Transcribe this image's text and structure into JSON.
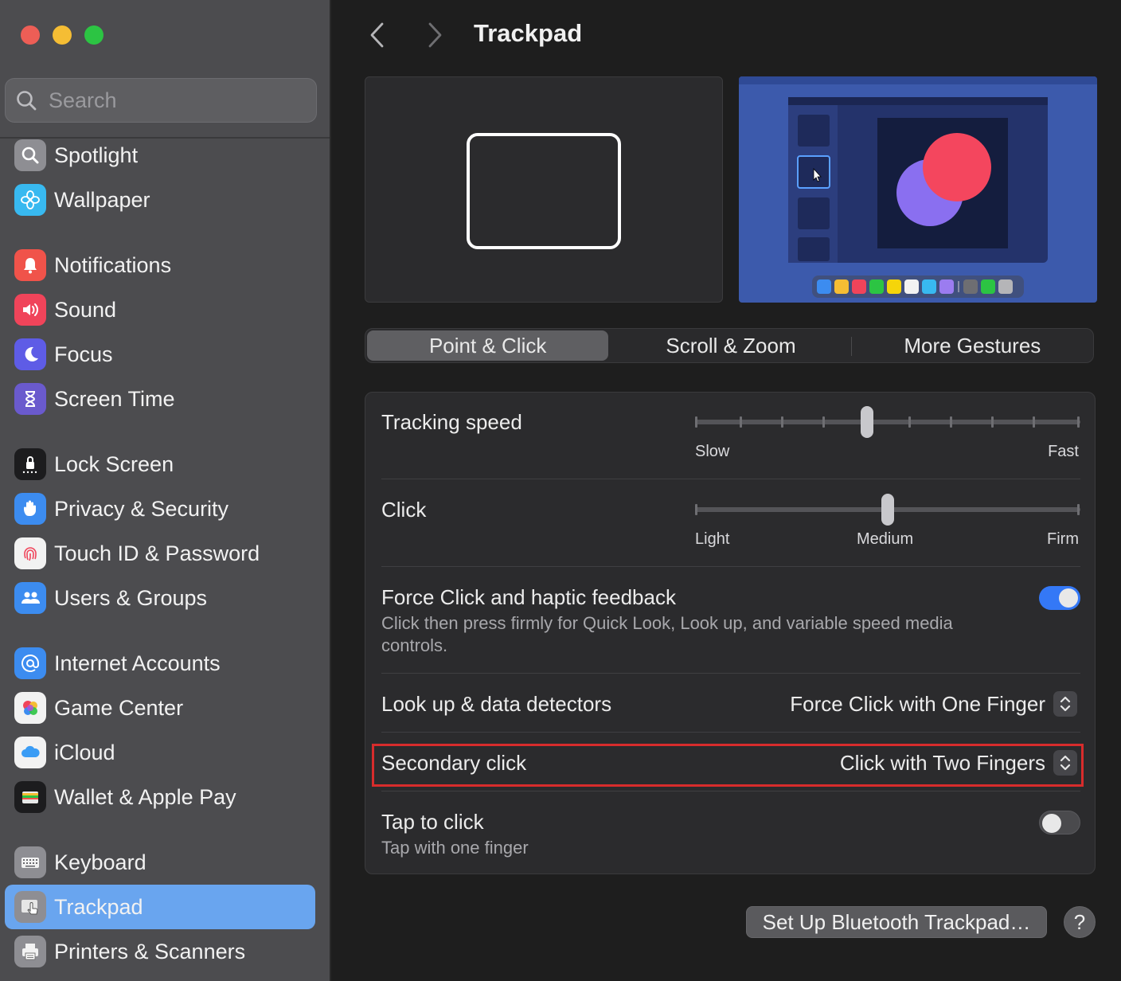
{
  "window": {
    "title": "Trackpad"
  },
  "search": {
    "placeholder": "Search"
  },
  "sidebar": {
    "items": [
      {
        "label": "Spotlight",
        "icon": "magnifier-icon",
        "color": "#8e8e93"
      },
      {
        "label": "Wallpaper",
        "icon": "flower-icon",
        "color": "#38b9f0"
      },
      {
        "label": "Notifications",
        "icon": "bell-icon",
        "color": "#f0534a"
      },
      {
        "label": "Sound",
        "icon": "speaker-icon",
        "color": "#f0445a"
      },
      {
        "label": "Focus",
        "icon": "moon-icon",
        "color": "#5e5ce6"
      },
      {
        "label": "Screen Time",
        "icon": "hourglass-icon",
        "color": "#6a5acd"
      },
      {
        "label": "Lock Screen",
        "icon": "lock-icon",
        "color": "#1c1c1e"
      },
      {
        "label": "Privacy & Security",
        "icon": "hand-icon",
        "color": "#3c8cf0"
      },
      {
        "label": "Touch ID & Password",
        "icon": "fingerprint-icon",
        "color": "#f2f2f2"
      },
      {
        "label": "Users & Groups",
        "icon": "users-icon",
        "color": "#3c8cf0"
      },
      {
        "label": "Internet Accounts",
        "icon": "at-icon",
        "color": "#3c8cf0"
      },
      {
        "label": "Game Center",
        "icon": "game-center-icon",
        "color": "#f2f2f2"
      },
      {
        "label": "iCloud",
        "icon": "cloud-icon",
        "color": "#f2f2f2"
      },
      {
        "label": "Wallet & Apple Pay",
        "icon": "wallet-icon",
        "color": "#1c1c1e"
      },
      {
        "label": "Keyboard",
        "icon": "keyboard-icon",
        "color": "#8e8e93"
      },
      {
        "label": "Trackpad",
        "icon": "trackpad-icon",
        "color": "#8e8e93",
        "selected": true
      },
      {
        "label": "Printers & Scanners",
        "icon": "printer-icon",
        "color": "#8e8e93"
      }
    ]
  },
  "tabs": [
    {
      "label": "Point & Click",
      "active": true
    },
    {
      "label": "Scroll & Zoom",
      "active": false
    },
    {
      "label": "More Gestures",
      "active": false
    }
  ],
  "settings": {
    "tracking_speed": {
      "label": "Tracking speed",
      "min_label": "Slow",
      "max_label": "Fast",
      "value": 5,
      "ticks": 10
    },
    "click": {
      "label": "Click",
      "min_label": "Light",
      "mid_label": "Medium",
      "max_label": "Firm",
      "value": 1,
      "ticks": 3
    },
    "force_click": {
      "label": "Force Click and haptic feedback",
      "description": "Click then press firmly for Quick Look, Look up, and variable speed media controls.",
      "enabled": true
    },
    "lookup": {
      "label": "Look up & data detectors",
      "value": "Force Click with One Finger"
    },
    "secondary_click": {
      "label": "Secondary click",
      "value": "Click with Two Fingers"
    },
    "tap_to_click": {
      "label": "Tap to click",
      "description": "Tap with one finger",
      "enabled": false
    }
  },
  "footer": {
    "bluetooth_button": "Set Up Bluetooth Trackpad…",
    "help_button": "?"
  },
  "colors": {
    "accent": "#3478f6",
    "selected_sidebar": "#69a5ef",
    "highlight": "#d82c2c"
  }
}
